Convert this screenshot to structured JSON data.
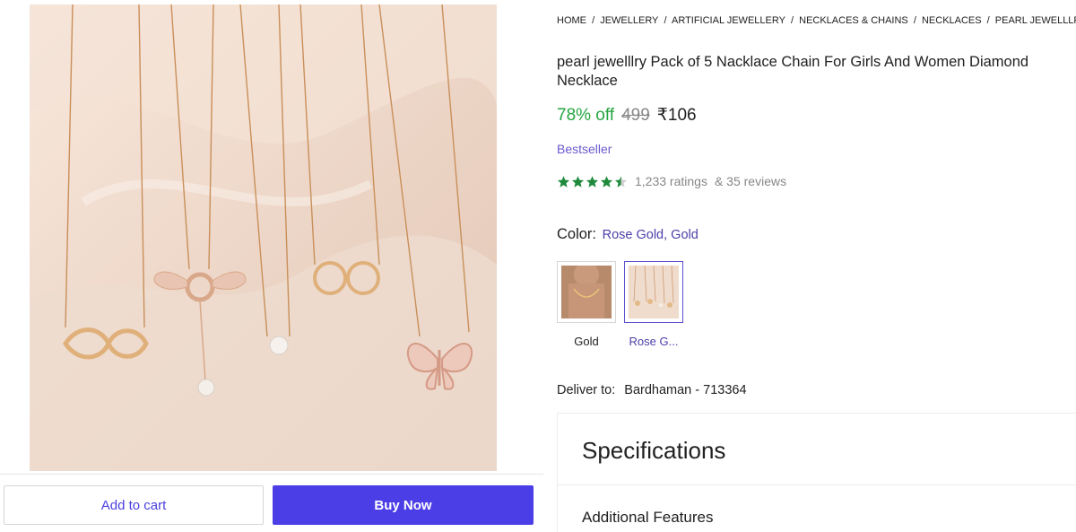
{
  "actions": {
    "add_to_cart": "Add to cart",
    "buy_now": "Buy Now"
  },
  "breadcrumb": [
    "HOME",
    "/",
    "JEWELLERY",
    "/",
    "ARTIFICIAL JEWELLERY",
    "/",
    "NECKLACES & CHAINS",
    "/",
    "NECKLACES",
    "/",
    "PEARL JEWELLLRY NECK"
  ],
  "product": {
    "title": "pearl jewelllry Pack of 5 Nacklace Chain For Girls And Women Diamond Necklace",
    "discount": "78% off",
    "mrp": "499",
    "price": "₹106",
    "badge": "Bestseller",
    "rating_stars": 4.5,
    "ratings": "1,233 ratings",
    "reviews": "& 35 reviews"
  },
  "color": {
    "label": "Color:",
    "value": "Rose Gold, Gold",
    "options": [
      {
        "label": "Gold",
        "selected": false
      },
      {
        "label": "Rose G...",
        "selected": true
      }
    ]
  },
  "delivery": {
    "label": "Deliver to:",
    "location": "Bardhaman - 713364"
  },
  "specifications": {
    "title": "Specifications",
    "section": "Additional Features"
  },
  "colors": {
    "accent": "#4b3ee6",
    "discount_green": "#26a541",
    "star_green": "#1f8a3b",
    "bestseller_purple": "#6a5acd"
  },
  "icons": [
    "star-icon"
  ]
}
